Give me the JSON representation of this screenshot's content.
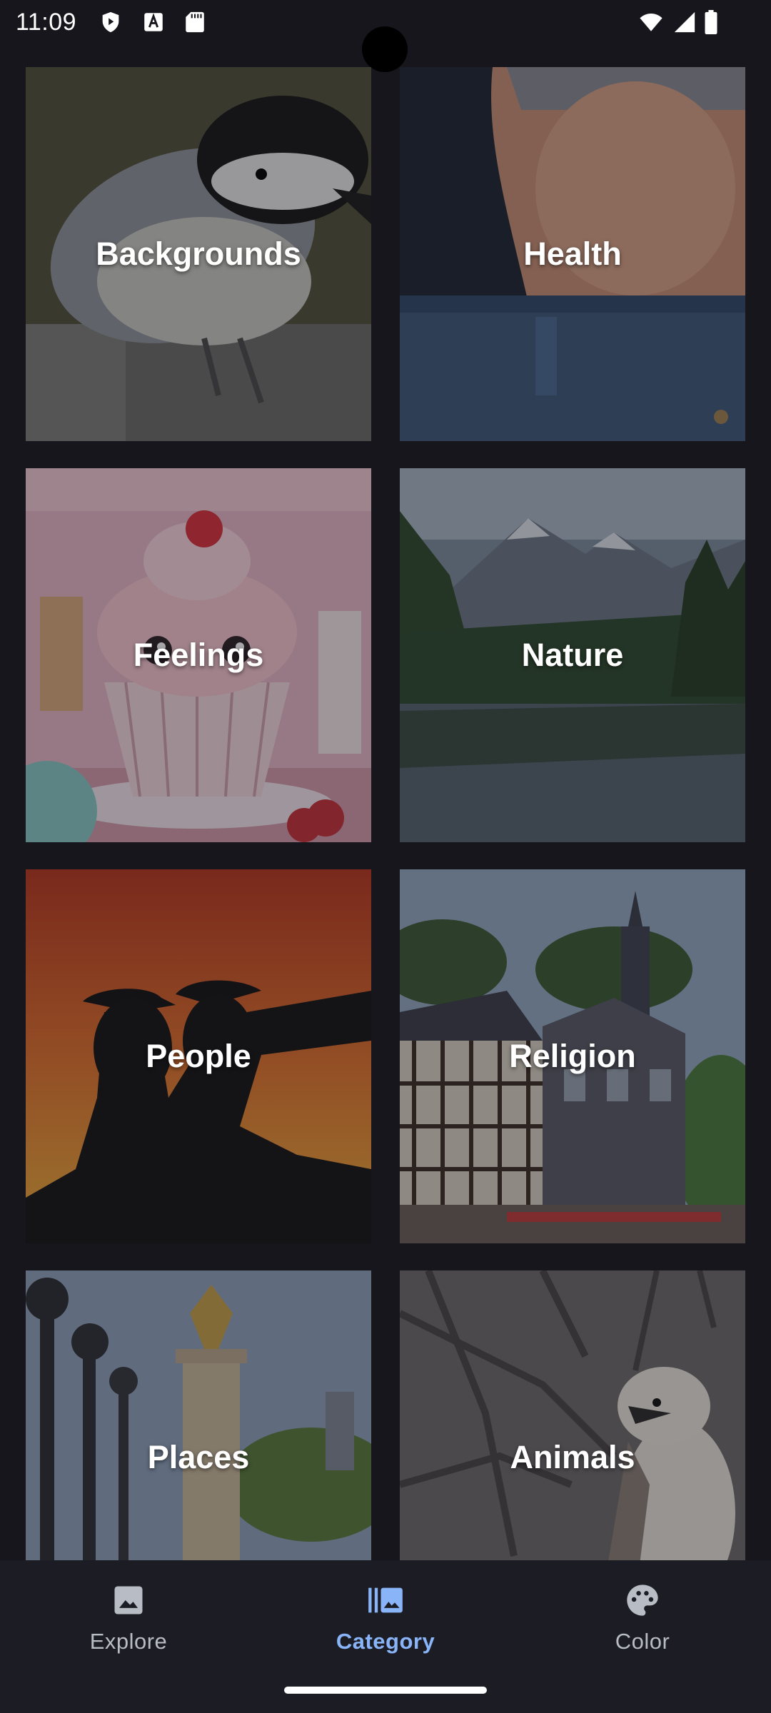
{
  "status_bar": {
    "time": "11:09",
    "left_icons": [
      "shield-play-icon",
      "font-a-icon",
      "sd-card-icon"
    ],
    "right_icons": [
      "wifi-icon",
      "signal-icon",
      "battery-icon"
    ]
  },
  "categories": [
    {
      "label": "Backgrounds",
      "image": "chickadee-bird"
    },
    {
      "label": "Health",
      "image": "belly-jeans"
    },
    {
      "label": "Feelings",
      "image": "cupcake-cartoon"
    },
    {
      "label": "Nature",
      "image": "mountain-lake"
    },
    {
      "label": "People",
      "image": "silhouette-sunset"
    },
    {
      "label": "Religion",
      "image": "church-town"
    },
    {
      "label": "Places",
      "image": "ornate-lampposts"
    },
    {
      "label": "Animals",
      "image": "kookaburra"
    }
  ],
  "bottom_nav": {
    "items": [
      {
        "label": "Explore",
        "icon": "image-icon",
        "active": false
      },
      {
        "label": "Category",
        "icon": "photo-library-icon",
        "active": true
      },
      {
        "label": "Color",
        "icon": "palette-icon",
        "active": false
      }
    ]
  },
  "colors": {
    "background": "#16161c",
    "nav_background": "#1c1c24",
    "accent": "#8ab4f8",
    "nav_inactive": "#b8bcc4"
  }
}
